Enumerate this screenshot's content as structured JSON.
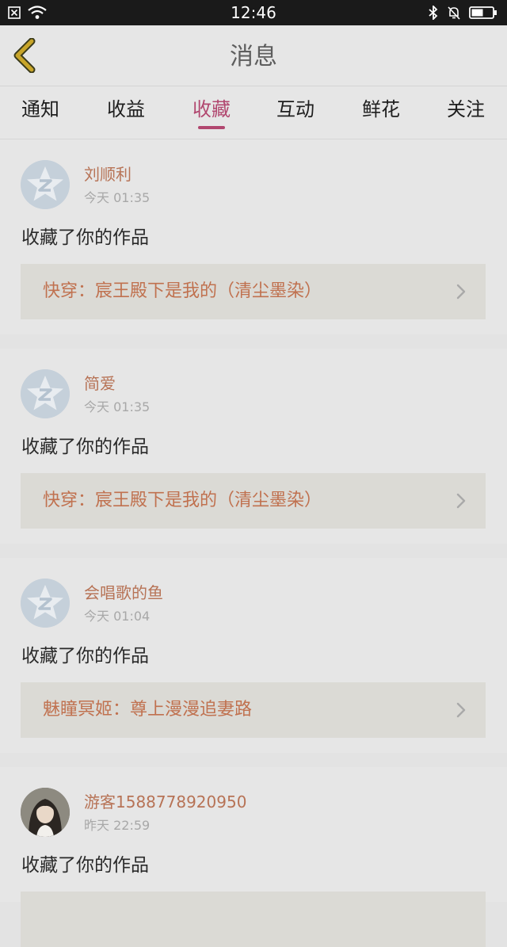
{
  "status_bar": {
    "time": "12:46"
  },
  "header": {
    "title": "消息"
  },
  "tabs": [
    {
      "label": "通知",
      "active": false
    },
    {
      "label": "收益",
      "active": false
    },
    {
      "label": "收藏",
      "active": true
    },
    {
      "label": "互动",
      "active": false
    },
    {
      "label": "鲜花",
      "active": false
    },
    {
      "label": "关注",
      "active": false
    }
  ],
  "messages": [
    {
      "username": "刘顺利",
      "time": "今天 01:35",
      "action": "收藏了你的作品",
      "work_title": "快穿：宸王殿下是我的（清尘墨染）",
      "avatar": "default-star-avatar"
    },
    {
      "username": "简爱",
      "time": "今天 01:35",
      "action": "收藏了你的作品",
      "work_title": "快穿：宸王殿下是我的（清尘墨染）",
      "avatar": "default-star-avatar"
    },
    {
      "username": "会唱歌的鱼",
      "time": "今天 01:04",
      "action": "收藏了你的作品",
      "work_title": "魅瞳冥姬：尊上漫漫追妻路",
      "avatar": "default-star-avatar"
    },
    {
      "username": "游客1588778920950",
      "time": "昨天 22:59",
      "action": "收藏了你的作品",
      "work_title": "",
      "avatar": "user-photo-avatar"
    }
  ],
  "colors": {
    "accent": "#b1476f",
    "username": "#b77356",
    "work_title": "#c0714f",
    "back_arrow": "#c8a52a"
  }
}
